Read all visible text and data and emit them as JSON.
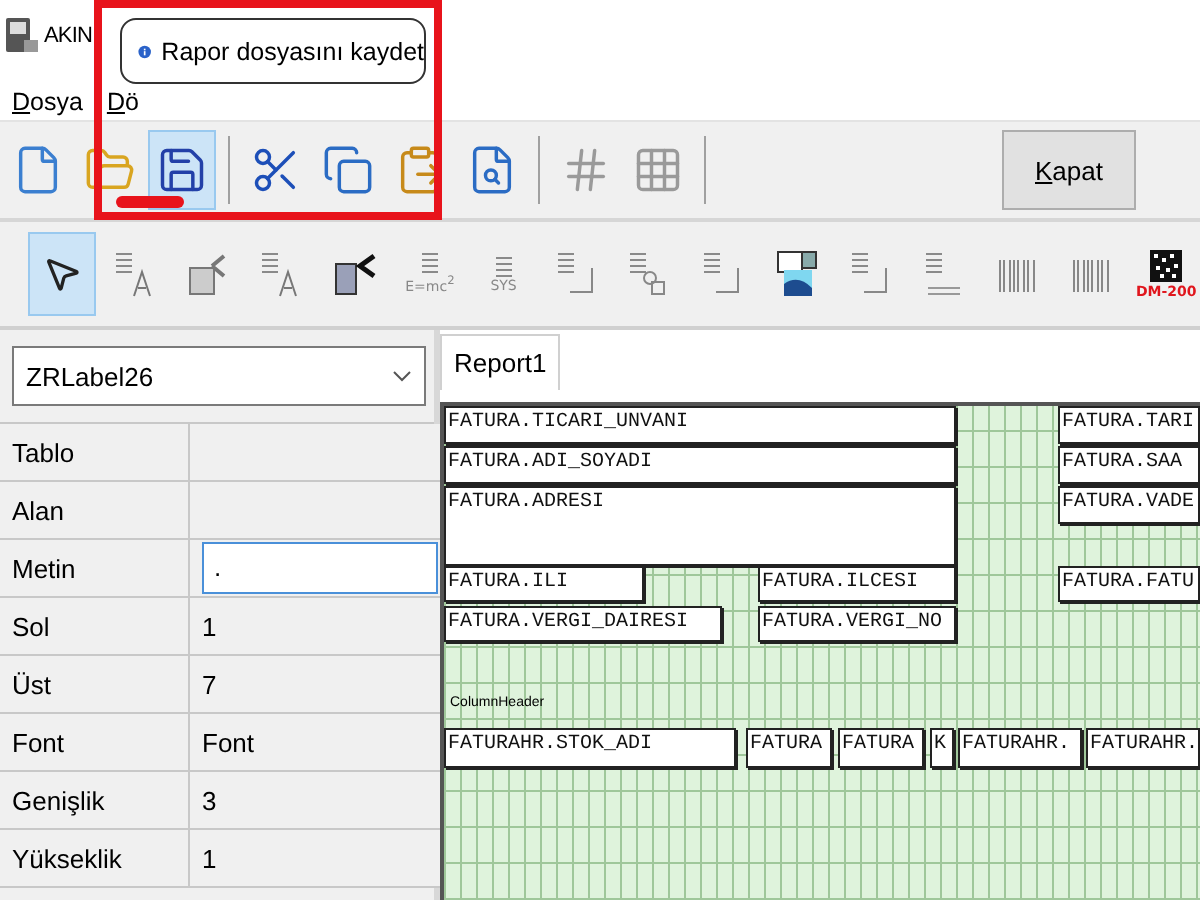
{
  "window": {
    "title": "AKIN"
  },
  "menu": [
    {
      "label": "Dosya"
    },
    {
      "label": "Dö"
    }
  ],
  "toolbar": {
    "buttons": [
      {
        "kind": "new",
        "selected": false,
        "disabled": false
      },
      {
        "kind": "open",
        "selected": false,
        "disabled": false
      },
      {
        "kind": "save",
        "selected": true,
        "disabled": false
      },
      {
        "kind": "cut",
        "selected": false,
        "disabled": false
      },
      {
        "kind": "copy",
        "selected": false,
        "disabled": false
      },
      {
        "kind": "paste",
        "selected": false,
        "disabled": false
      },
      {
        "kind": "preview",
        "selected": false,
        "disabled": false
      },
      {
        "kind": "grid",
        "selected": false,
        "disabled": true
      },
      {
        "kind": "snap",
        "selected": false,
        "disabled": true
      }
    ],
    "close_button": "Kapat"
  },
  "tooltip": {
    "text": "Rapor dosyasını kaydet"
  },
  "components": [
    {
      "kind": "pointer",
      "selected": true
    },
    {
      "kind": "label",
      "selected": false
    },
    {
      "kind": "dbimage",
      "selected": false
    },
    {
      "kind": "dblabel",
      "selected": false
    },
    {
      "kind": "richtext",
      "selected": false
    },
    {
      "kind": "expr",
      "selected": false,
      "caption": "E=mc$^{2}$"
    },
    {
      "kind": "sysdata",
      "selected": false,
      "caption": "SYS"
    },
    {
      "kind": "frame",
      "selected": false
    },
    {
      "kind": "shape",
      "selected": false
    },
    {
      "kind": "frame",
      "selected": false
    },
    {
      "kind": "image",
      "selected": false
    },
    {
      "kind": "frame",
      "selected": false
    },
    {
      "kind": "memo",
      "selected": false
    },
    {
      "kind": "barcode",
      "selected": false
    },
    {
      "kind": "barcode",
      "selected": false
    },
    {
      "kind": "datamatrix",
      "selected": false,
      "caption": "DM-200"
    }
  ],
  "object_selector": {
    "value": "ZRLabel26"
  },
  "properties": [
    {
      "name": "Tablo"
    },
    {
      "name": "Alan"
    },
    {
      "name": "Metin",
      "value": ".",
      "editing": true
    },
    {
      "name": "Sol",
      "value": "1"
    },
    {
      "name": "Üst",
      "value": "7"
    },
    {
      "name": "Font",
      "value": "Font"
    },
    {
      "name": "Genişlik",
      "value": "3"
    },
    {
      "name": "Yükseklik",
      "value": "1"
    }
  ],
  "report": {
    "tabs": [
      {
        "label": "Report1",
        "selected": true
      }
    ],
    "band_caption": "ColumnHeader",
    "fields": [
      {
        "text": "FATURA.TICARI_UNVANI"
      },
      {
        "text": "FATURA.ADI_SOYADI"
      },
      {
        "text": "FATURA.ADRESI"
      },
      {
        "text": "FATURA.ILI"
      },
      {
        "text": "FATURA.ILCESI"
      },
      {
        "text": "FATURA.VERGI_DAIRESI"
      },
      {
        "text": "FATURA.VERGI_NO"
      },
      {
        "text": "FATURA.TARI"
      },
      {
        "text": "FATURA.SAA"
      },
      {
        "text": "FATURA.VADE"
      },
      {
        "text": "FATURA.FATU"
      },
      {
        "text": "FATURAHR.STOK_ADI"
      },
      {
        "text": "FATURA"
      },
      {
        "text": "FATURA"
      },
      {
        "text": "K"
      },
      {
        "text": "FATURAHR."
      },
      {
        "text": "FATURAHR."
      }
    ]
  }
}
